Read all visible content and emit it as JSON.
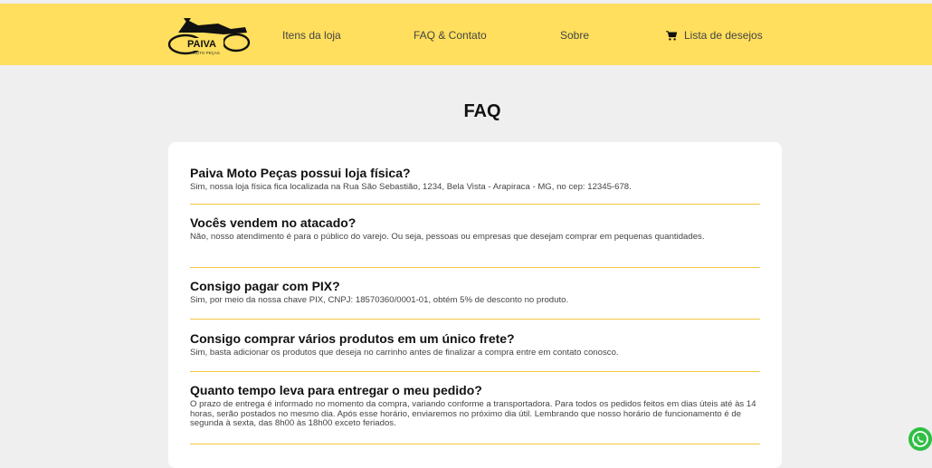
{
  "brand": {
    "name": "PAIVA",
    "subtitle": "MOTO PEÇAS",
    "accent": "#ffdf5d",
    "divider_color": "#f2c640"
  },
  "nav": {
    "items": [
      {
        "label": "Itens da loja"
      },
      {
        "label": "FAQ & Contato"
      },
      {
        "label": "Sobre"
      },
      {
        "label": "Lista de desejos",
        "icon": "cart-icon"
      }
    ]
  },
  "page": {
    "title": "FAQ"
  },
  "faq": [
    {
      "question": "Paiva Moto Peças possui loja física?",
      "answer": "Sim, nossa loja física fica localizada na Rua São Sebastião, 1234, Bela Vista - Arapiraca - MG, no cep: 12345-678."
    },
    {
      "question": "Vocês vendem no atacado?",
      "answer": "Não, nosso atendimento é para o público do varejo. Ou seja, pessoas ou empresas que desejam comprar em pequenas quantidades."
    },
    {
      "question": "Consigo pagar com PIX?",
      "answer": "Sim, por meio da nossa chave PIX, CNPJ: 18570360/0001-01, obtém 5% de desconto no produto."
    },
    {
      "question": "Consigo comprar vários produtos em um único frete?",
      "answer": "Sim, basta adicionar os produtos que deseja no carrinho antes de finalizar a compra entre em contato conosco."
    },
    {
      "question": "Quanto tempo leva para entregar o meu pedido?",
      "answer": "O prazo de entrega é informado no momento da compra, variando conforme a transportadora. Para todos os pedidos feitos em dias úteis até às 14 horas, serão postados no mesmo dia. Após esse horário, enviaremos no próximo dia útil. Lembrando que nosso horário de funcionamento é de segunda à sexta, das 8h00 às 18h00 exceto feriados."
    }
  ],
  "floating": {
    "icon": "whatsapp-icon",
    "color": "#2fbf45"
  }
}
